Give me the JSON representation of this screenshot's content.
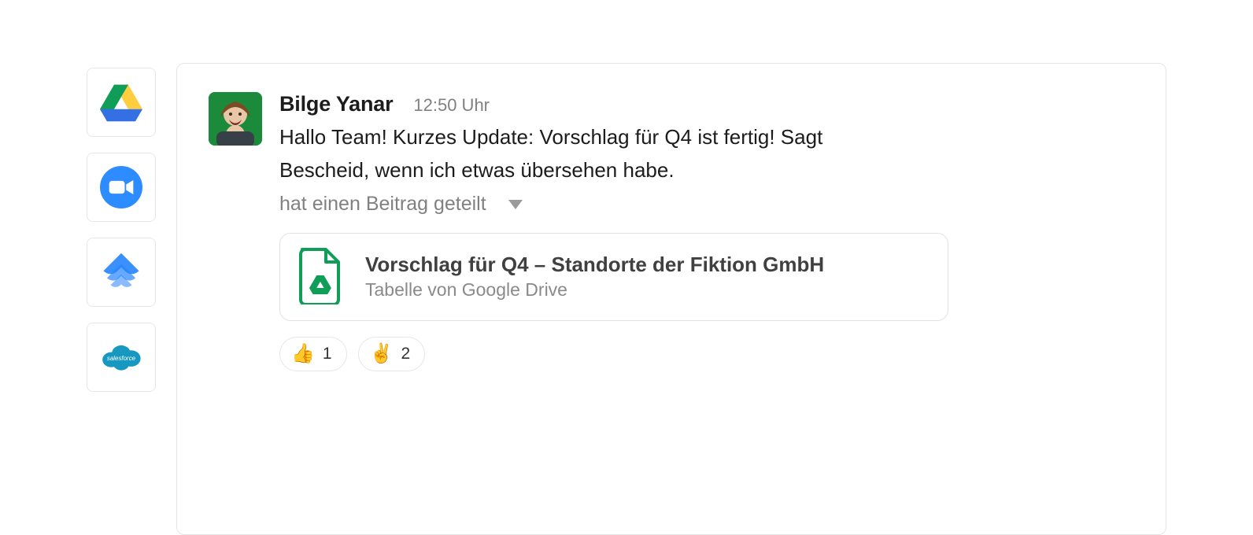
{
  "rail": {
    "apps": [
      {
        "name": "google-drive"
      },
      {
        "name": "zoom"
      },
      {
        "name": "jira"
      },
      {
        "name": "salesforce",
        "label": "salesforce"
      }
    ]
  },
  "message": {
    "author": "Bilge Yanar",
    "timestamp": "12:50 Uhr",
    "text": "Hallo Team! Kurzes Update: Vorschlag für Q4 ist fertig! Sagt Bescheid, wenn ich etwas übersehen habe.",
    "shared_label": "hat einen Beitrag geteilt"
  },
  "attachment": {
    "title": "Vorschlag für Q4 – Standorte der Fiktion GmbH",
    "subtitle": "Tabelle von Google Drive",
    "icon": "google-drive-file-icon"
  },
  "reactions": [
    {
      "emoji": "👍",
      "count": "1",
      "name": "thumbs-up"
    },
    {
      "emoji": "✌️",
      "count": "2",
      "name": "victory-hand"
    }
  ],
  "colors": {
    "accent_green": "#1b8a3a",
    "drive_green": "#0f9d58",
    "drive_yellow": "#ffcd40",
    "drive_blue": "#3470e4",
    "zoom_blue": "#2d8cff",
    "jira_blue": "#2684ff",
    "salesforce_blue": "#1798c1"
  }
}
